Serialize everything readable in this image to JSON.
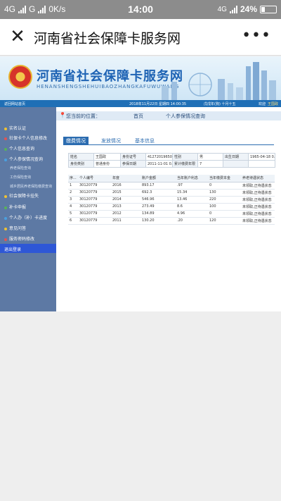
{
  "statusbar": {
    "network1": "4G",
    "network2": "G",
    "speed": "0K/s",
    "time": "14:00",
    "network3": "4G",
    "battery": "24%"
  },
  "titlebar": {
    "close_icon": "close-icon",
    "title": "河南省社会保障卡服务网",
    "more_icon": "more-icon"
  },
  "banner": {
    "title": "河南省社会保障卡服务网",
    "subtitle": "HENANSHENGSHEHUIBAOZHANGKAFUWUWANG"
  },
  "strip": {
    "home_link": "返回网站首页",
    "datetime": "2018年11月22日 星期四 14:00:35",
    "lunar": "戊戌年(狗) 十月十五",
    "welcome": "欢迎",
    "user": "王国政"
  },
  "sidebar": {
    "items": [
      {
        "label": "实名认证",
        "type": "main"
      },
      {
        "label": "社保卡个人信息修改",
        "type": "main"
      },
      {
        "label": "个人信息查询",
        "type": "main"
      },
      {
        "label": "个人参保情况查询",
        "type": "main"
      },
      {
        "label": "养老保险查询",
        "type": "sub"
      },
      {
        "label": "工伤保险查询",
        "type": "sub"
      },
      {
        "label": "城乡居民养老保险缴费查询",
        "type": "sub"
      },
      {
        "label": "社会保障卡挂失",
        "type": "main"
      },
      {
        "label": "补卡申报",
        "type": "main"
      },
      {
        "label": "个人办（补）卡进度",
        "type": "main"
      },
      {
        "label": "意见问答",
        "type": "main"
      },
      {
        "label": "服务密码修改",
        "type": "main"
      },
      {
        "label": "退出登录",
        "type": "main",
        "active": true
      }
    ]
  },
  "breadcrumb": {
    "label": "您当前的位置：",
    "home": "首页",
    "current": "个人参保情况查询"
  },
  "tabs": [
    {
      "label": "缴费情况",
      "active": true
    },
    {
      "label": "发放情况",
      "active": false
    },
    {
      "label": "基本信息",
      "active": false
    }
  ],
  "info": {
    "rows": [
      [
        "姓名",
        "王国政",
        "身份证号",
        "41272019650...",
        "性别",
        "男",
        "出生日期",
        "1965-04-18 0..."
      ],
      [
        "身份类别",
        "普通身份",
        "参保日期",
        "2011-11-01 0...",
        "累计缴费年限",
        "7",
        "",
        ""
      ]
    ]
  },
  "history": {
    "headers": [
      "序...",
      "个人编号",
      "年度",
      "账户金额",
      "当年账户利息",
      "当年缴费本金",
      "养老待遇状态"
    ],
    "rows": [
      [
        "1",
        "30120779",
        "2016",
        "893.17",
        ".97",
        "0",
        "未领取,正待遇状态"
      ],
      [
        "2",
        "30120779",
        "2015",
        "692.3",
        "15.34",
        "130",
        "未领取,正待遇状态"
      ],
      [
        "3",
        "30120779",
        "2014",
        "546.96",
        "13.46",
        "220",
        "未领取,正待遇状态"
      ],
      [
        "4",
        "30120779",
        "2013",
        "273.49",
        "8.6",
        "100",
        "未领取,正待遇状态"
      ],
      [
        "5",
        "30120779",
        "2012",
        "134.89",
        "4.96",
        "0",
        "未领取,正待遇状态"
      ],
      [
        "6",
        "30120779",
        "2011",
        "130.20",
        ".20",
        "120",
        "未领取,正待遇状态"
      ]
    ]
  }
}
